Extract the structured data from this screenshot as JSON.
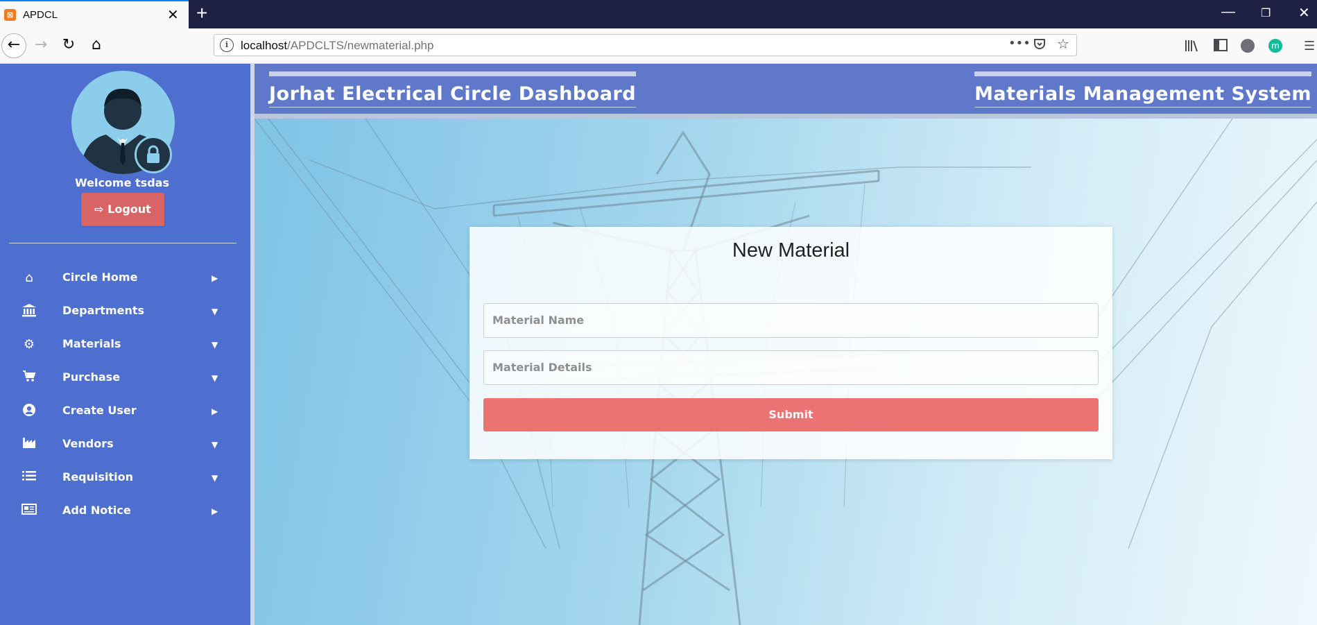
{
  "browser": {
    "tab_title": "APDCL",
    "tab_close": "✕",
    "new_tab": "+",
    "url_host": "localhost",
    "url_path": "/APDCLTS/newmaterial.php",
    "window_controls": {
      "minimize": "—",
      "restore": "❐",
      "close": "✕"
    },
    "icons": [
      "back-icon",
      "forward-icon",
      "reload-icon",
      "home-icon",
      "info-icon",
      "more-icon",
      "pocket-icon",
      "star-icon",
      "library-icon",
      "sidebar-icon",
      "account-icon",
      "extension-icon",
      "menu-icon"
    ]
  },
  "sidebar": {
    "welcome": "Welcome tsdas",
    "logout_label": "Logout",
    "items": [
      {
        "label": "Circle Home",
        "icon": "home-icon",
        "caret": "▶"
      },
      {
        "label": "Departments",
        "icon": "bank-icon",
        "caret": "▼"
      },
      {
        "label": "Materials",
        "icon": "cogs-icon",
        "caret": "▼"
      },
      {
        "label": "Purchase",
        "icon": "cart-icon",
        "caret": "▼"
      },
      {
        "label": "Create User",
        "icon": "user-circle-icon",
        "caret": "▶"
      },
      {
        "label": "Vendors",
        "icon": "industry-icon",
        "caret": "▼"
      },
      {
        "label": "Requisition",
        "icon": "list-icon",
        "caret": "▼"
      },
      {
        "label": "Add Notice",
        "icon": "newspaper-icon",
        "caret": "▶"
      }
    ]
  },
  "header": {
    "left_title": "Jorhat Electrical Circle Dashboard",
    "right_title": "Materials Management System"
  },
  "form": {
    "title": "New Material",
    "material_name_placeholder": "Material Name",
    "material_details_placeholder": "Material Details",
    "submit_label": "Submit"
  },
  "colors": {
    "sidebar": "#4f6fd0",
    "header": "#6078c9",
    "logout": "#d96465",
    "submit": "#ec6b6c"
  }
}
